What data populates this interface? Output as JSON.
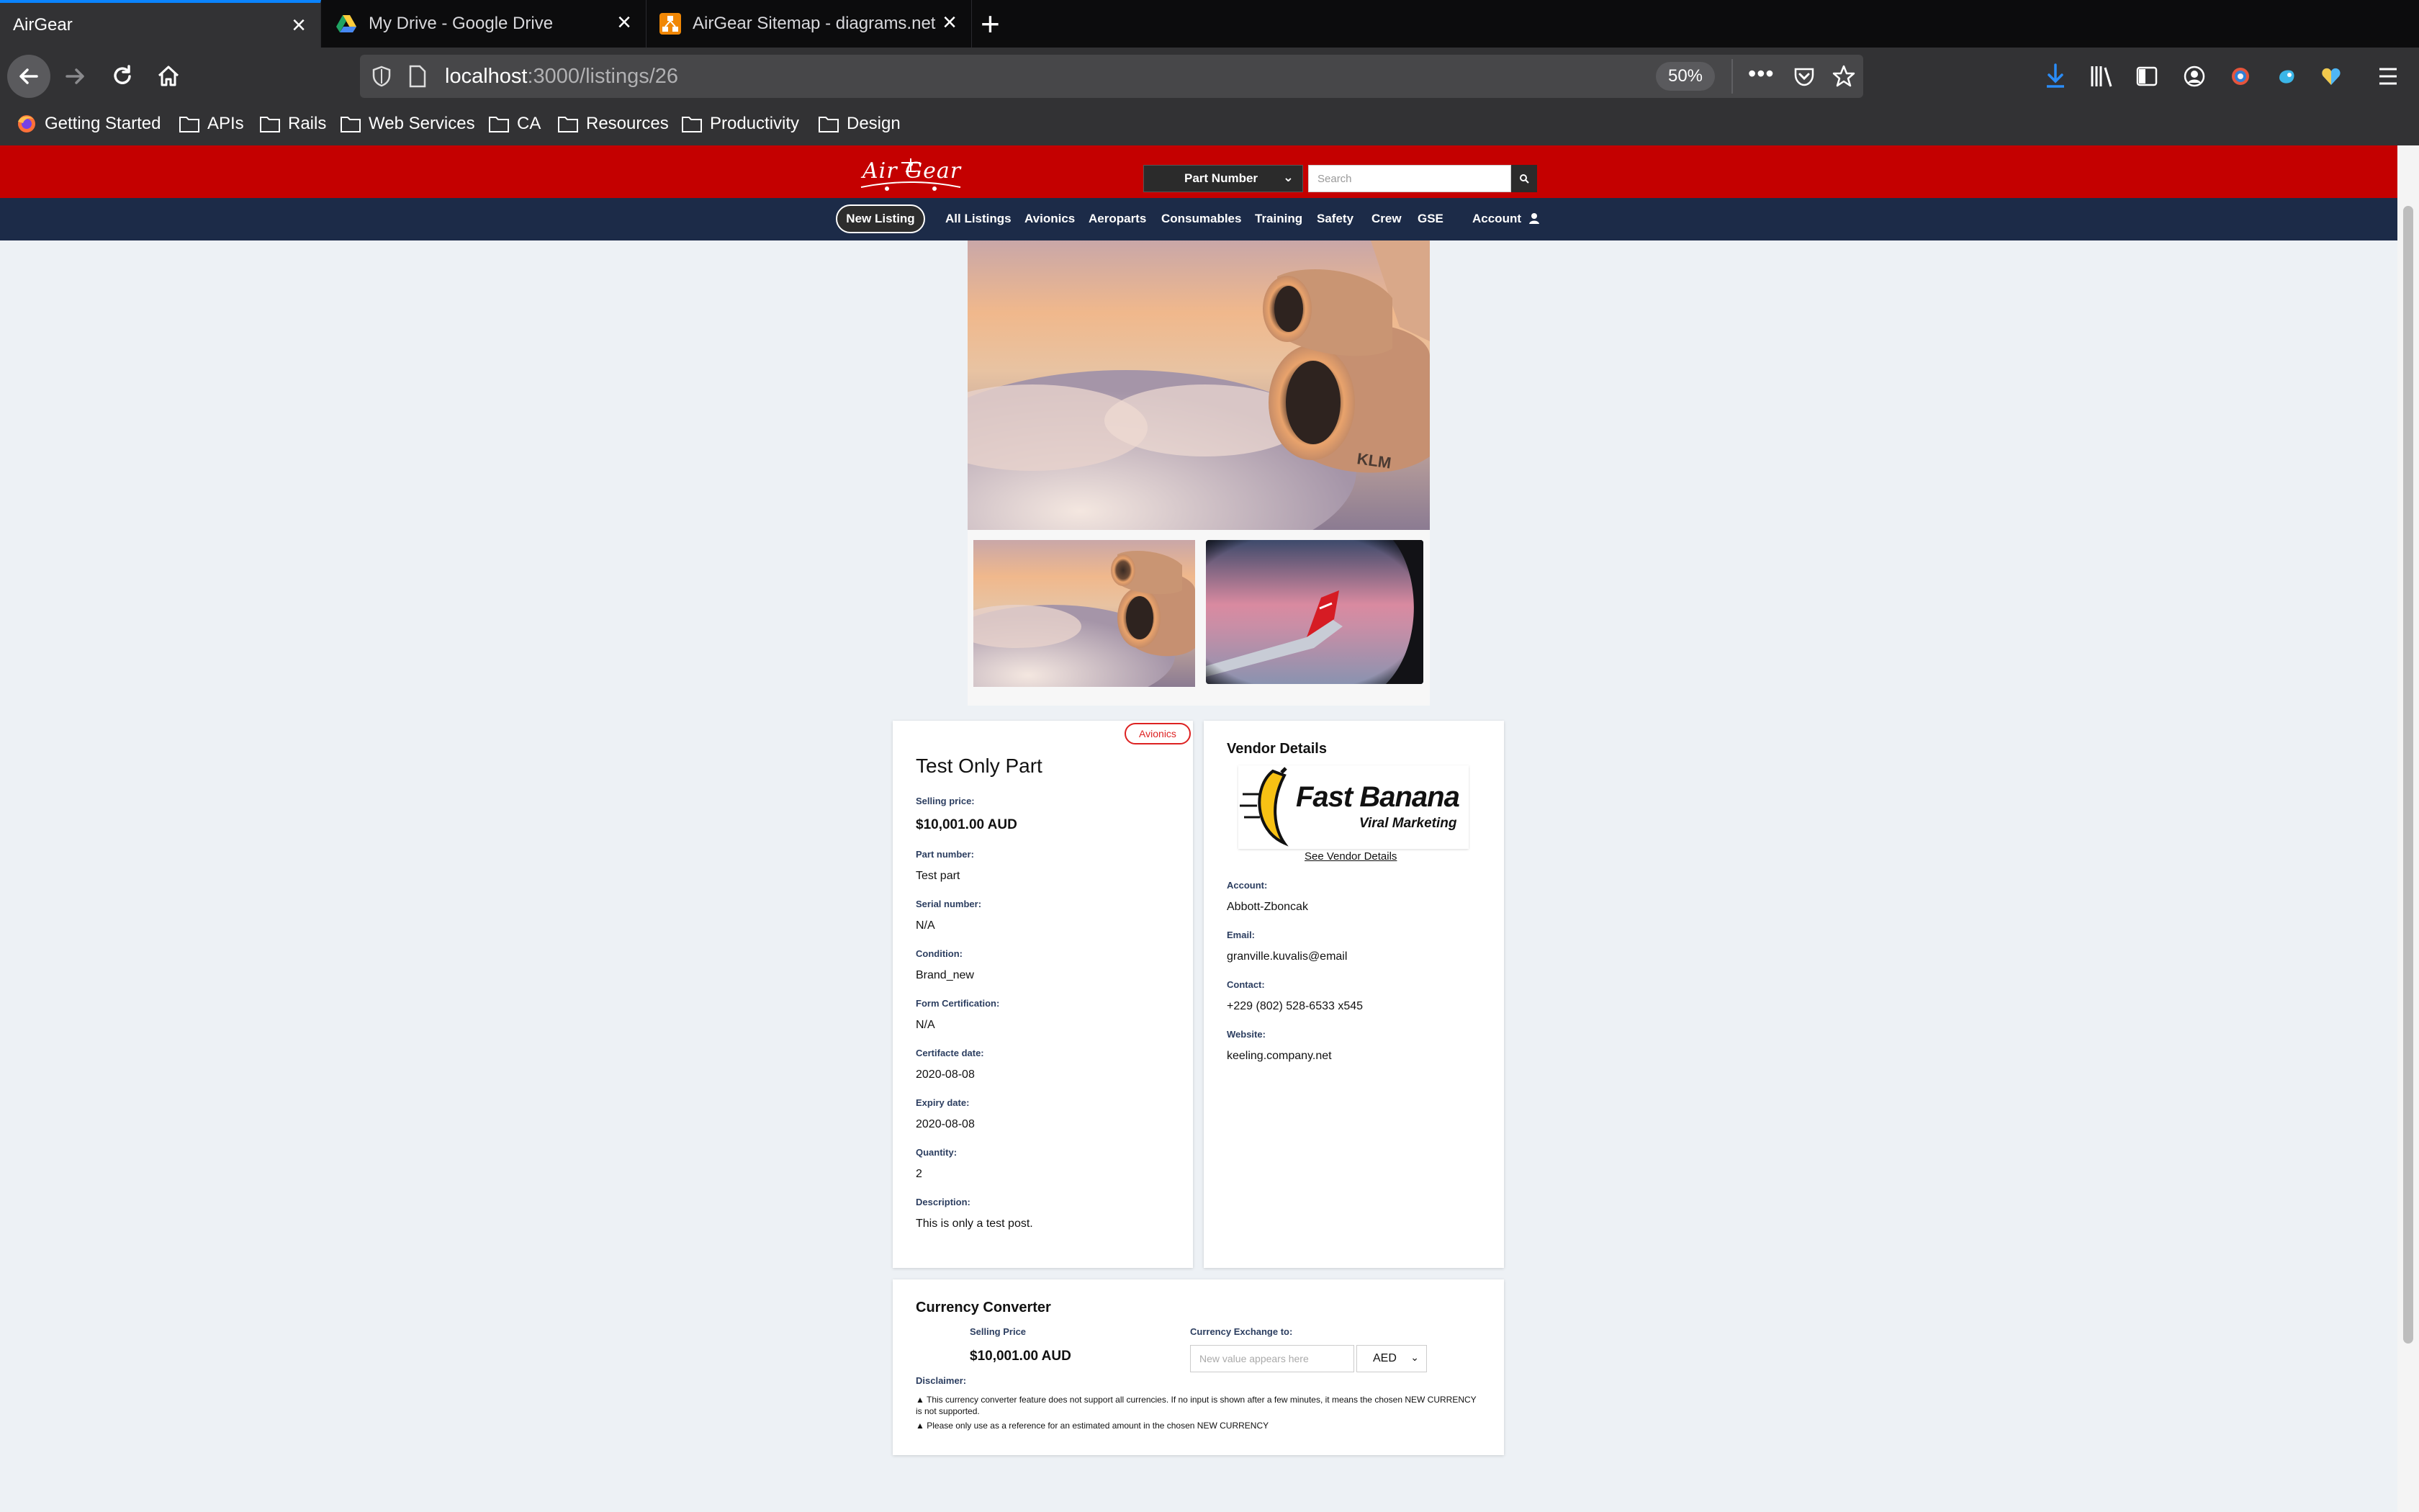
{
  "browser": {
    "tabs": [
      {
        "title": "AirGear",
        "active": true
      },
      {
        "title": "My Drive - Google Drive",
        "active": false
      },
      {
        "title": "AirGear Sitemap - diagrams.net",
        "active": false
      }
    ],
    "url_host": "localhost",
    "url_path": ":3000/listings/26",
    "zoom": "50%",
    "bookmarks": [
      "Getting Started",
      "APIs",
      "Rails",
      "Web Services",
      "CA",
      "Resources",
      "Productivity",
      "Design"
    ]
  },
  "site": {
    "logo_text": "Air Gear",
    "search_type": "Part Number",
    "search_placeholder": "Search",
    "new_listing": "New Listing",
    "nav": [
      "All Listings",
      "Avionics",
      "Aeroparts",
      "Consumables",
      "Training",
      "Safety",
      "Crew",
      "GSE"
    ],
    "account": "Account"
  },
  "listing": {
    "category_badge": "Avionics",
    "title": "Test Only Part",
    "fields": [
      {
        "label": "Selling price:",
        "value": "$10,001.00 AUD"
      },
      {
        "label": "Part number:",
        "value": "Test part"
      },
      {
        "label": "Serial number:",
        "value": "N/A"
      },
      {
        "label": "Condition:",
        "value": "Brand_new"
      },
      {
        "label": "Form Certification:",
        "value": "N/A"
      },
      {
        "label": "Certifacte date:",
        "value": "2020-08-08"
      },
      {
        "label": "Expiry date:",
        "value": "2020-08-08"
      },
      {
        "label": "Quantity:",
        "value": "2"
      },
      {
        "label": "Description:",
        "value": "This is only a test post."
      }
    ]
  },
  "vendor": {
    "heading": "Vendor Details",
    "logo_name": "Fast Banana",
    "logo_tagline": "Viral Marketing",
    "see_details": "See Vendor Details",
    "fields": [
      {
        "label": "Account:",
        "value": "Abbott-Zboncak"
      },
      {
        "label": "Email:",
        "value": "granville.kuvalis@email"
      },
      {
        "label": "Contact:",
        "value": "+229 (802) 528-6533 x545"
      },
      {
        "label": "Website:",
        "value": "keeling.company.net"
      }
    ]
  },
  "currency": {
    "heading": "Currency Converter",
    "selling_label": "Selling Price",
    "selling_value": "$10,001.00 AUD",
    "exchange_label": "Currency Exchange to:",
    "input_placeholder": "New value appears here",
    "selected_currency": "AED",
    "disclaimer_label": "Disclaimer:",
    "disclaimer_1": "This currency converter feature does not support all currencies. If no input is shown after a few minutes, it means the chosen NEW CURRENCY is not supported.",
    "disclaimer_2": "Please only use as a reference for an estimated amount in the chosen NEW CURRENCY"
  }
}
